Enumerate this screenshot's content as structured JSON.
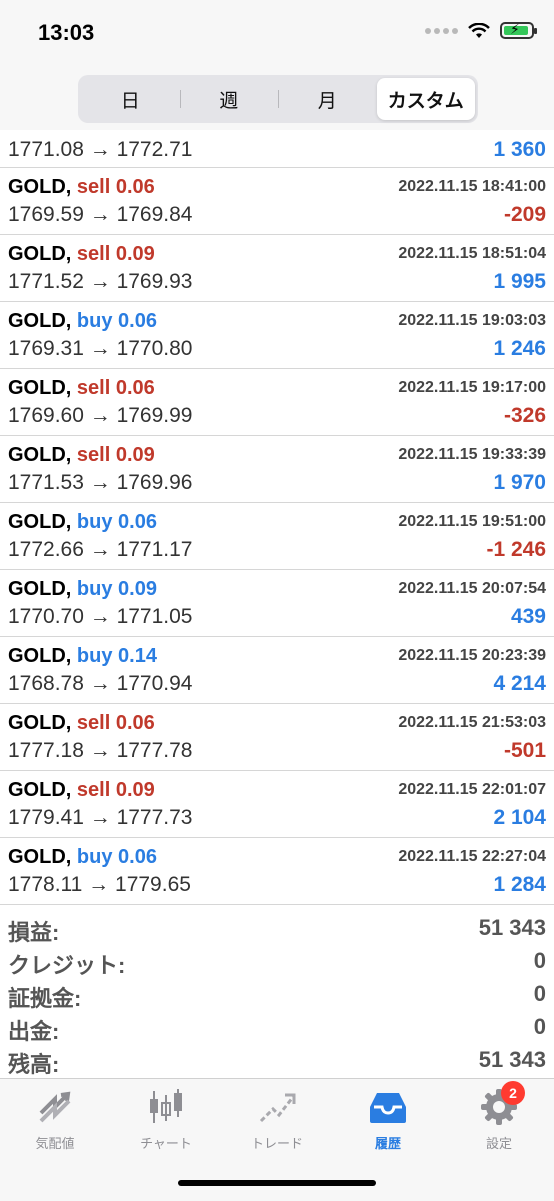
{
  "status": {
    "time": "13:03"
  },
  "segments": [
    {
      "label": "日"
    },
    {
      "label": "週"
    },
    {
      "label": "月"
    },
    {
      "label": "カスタム"
    }
  ],
  "partial_row": {
    "prices": "1771.08 → 1772.71",
    "profit": "1 360"
  },
  "trades": [
    {
      "symbol": "GOLD,",
      "direction": "sell",
      "volume": "sell 0.06",
      "datetime": "2022.11.15 18:41:00",
      "prices": "1769.59 → 1769.84",
      "profit": "-209",
      "profit_sign": "neg"
    },
    {
      "symbol": "GOLD,",
      "direction": "sell",
      "volume": "sell 0.09",
      "datetime": "2022.11.15 18:51:04",
      "prices": "1771.52 → 1769.93",
      "profit": "1 995",
      "profit_sign": "pos"
    },
    {
      "symbol": "GOLD,",
      "direction": "buy",
      "volume": "buy 0.06",
      "datetime": "2022.11.15 19:03:03",
      "prices": "1769.31 → 1770.80",
      "profit": "1 246",
      "profit_sign": "pos"
    },
    {
      "symbol": "GOLD,",
      "direction": "sell",
      "volume": "sell 0.06",
      "datetime": "2022.11.15 19:17:00",
      "prices": "1769.60 → 1769.99",
      "profit": "-326",
      "profit_sign": "neg"
    },
    {
      "symbol": "GOLD,",
      "direction": "sell",
      "volume": "sell 0.09",
      "datetime": "2022.11.15 19:33:39",
      "prices": "1771.53 → 1769.96",
      "profit": "1 970",
      "profit_sign": "pos"
    },
    {
      "symbol": "GOLD,",
      "direction": "buy",
      "volume": "buy 0.06",
      "datetime": "2022.11.15 19:51:00",
      "prices": "1772.66 → 1771.17",
      "profit": "-1 246",
      "profit_sign": "neg"
    },
    {
      "symbol": "GOLD,",
      "direction": "buy",
      "volume": "buy 0.09",
      "datetime": "2022.11.15 20:07:54",
      "prices": "1770.70 → 1771.05",
      "profit": "439",
      "profit_sign": "pos"
    },
    {
      "symbol": "GOLD,",
      "direction": "buy",
      "volume": "buy 0.14",
      "datetime": "2022.11.15 20:23:39",
      "prices": "1768.78 → 1770.94",
      "profit": "4 214",
      "profit_sign": "pos"
    },
    {
      "symbol": "GOLD,",
      "direction": "sell",
      "volume": "sell 0.06",
      "datetime": "2022.11.15 21:53:03",
      "prices": "1777.18 → 1777.78",
      "profit": "-501",
      "profit_sign": "neg"
    },
    {
      "symbol": "GOLD,",
      "direction": "sell",
      "volume": "sell 0.09",
      "datetime": "2022.11.15 22:01:07",
      "prices": "1779.41 → 1777.73",
      "profit": "2 104",
      "profit_sign": "pos"
    },
    {
      "symbol": "GOLD,",
      "direction": "buy",
      "volume": "buy 0.06",
      "datetime": "2022.11.15 22:27:04",
      "prices": "1778.11 → 1779.65",
      "profit": "1 284",
      "profit_sign": "pos"
    }
  ],
  "summary": [
    {
      "label": "損益:",
      "value": "51 343"
    },
    {
      "label": "クレジット:",
      "value": "0"
    },
    {
      "label": "証拠金:",
      "value": "0"
    },
    {
      "label": "出金:",
      "value": "0"
    },
    {
      "label": "残高:",
      "value": "51 343"
    }
  ],
  "tabs": [
    {
      "label": "気配値",
      "icon": "quotes-icon"
    },
    {
      "label": "チャート",
      "icon": "chart-icon"
    },
    {
      "label": "トレード",
      "icon": "trade-icon"
    },
    {
      "label": "履歴",
      "icon": "history-icon"
    },
    {
      "label": "設定",
      "icon": "gear-icon",
      "badge": "2"
    }
  ],
  "colors": {
    "sell": "#c0392b",
    "buy": "#2a7de1",
    "active_tab": "#2a7de1",
    "inactive_tab": "#8e8e93"
  }
}
